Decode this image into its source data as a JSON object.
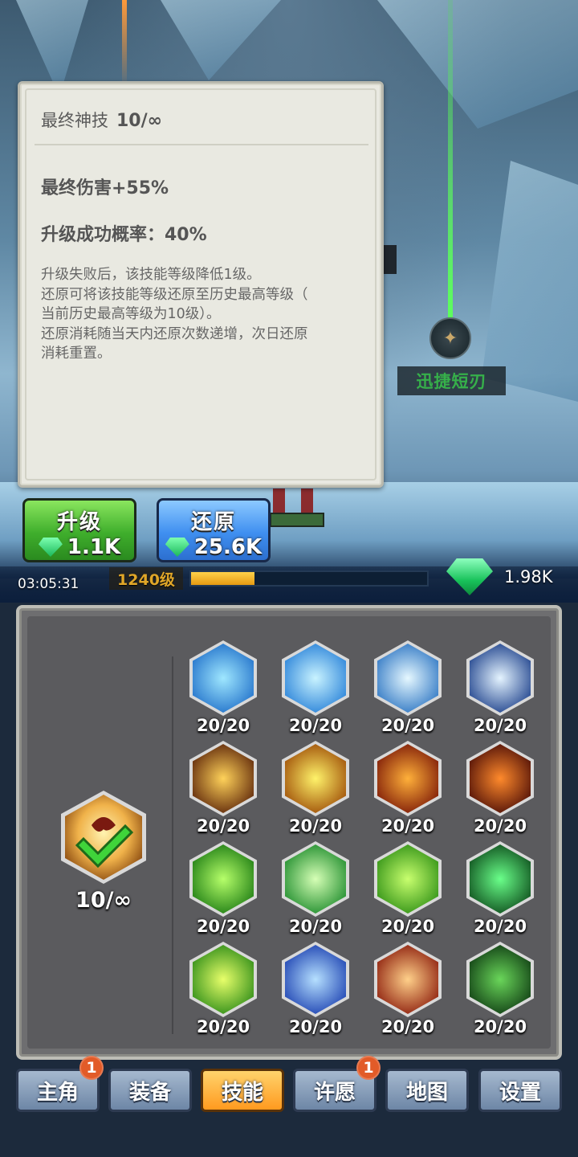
{
  "tooltip": {
    "title": "最终神技",
    "level": "10/∞",
    "effect": "最终伤害+55%",
    "success_rate": "升级成功概率：40%",
    "description": [
      "升级失败后，该技能等级降低1级。",
      "还原可将该技能等级还原至历史最高等级（",
      "当前历史最高等级为10级）。",
      "还原消耗随当天内还原次数递增，次日还原",
      "消耗重置。"
    ]
  },
  "scene": {
    "dagger_label": "迅捷短刃",
    "dagger_icon": "dagger-icon"
  },
  "actions": {
    "upgrade": {
      "label": "升级",
      "cost": "1.1K",
      "icon": "gem-icon",
      "color": "#3fae2c"
    },
    "restore": {
      "label": "还原",
      "cost": "25.6K",
      "icon": "gem-icon",
      "color": "#3f8ff0"
    }
  },
  "status": {
    "timer": "03:05:31",
    "player_level": "1240级",
    "xp_fraction": 0.27,
    "gem_total": "1.98K"
  },
  "main_skill": {
    "level": "10/∞",
    "icon": "final-skill-checkmark-icon"
  },
  "skills": [
    {
      "name": "ice-burst-icon",
      "count": "20/20",
      "colors": [
        "#9fe7ff",
        "#1f6fc9"
      ]
    },
    {
      "name": "ice-tornado-icon",
      "count": "20/20",
      "colors": [
        "#c9f3ff",
        "#2680d8"
      ]
    },
    {
      "name": "frost-wave-icon",
      "count": "20/20",
      "colors": [
        "#e6f8ff",
        "#2b74c2"
      ]
    },
    {
      "name": "ice-shards-icon",
      "count": "20/20",
      "colors": [
        "#e5f4ff",
        "#1b3f8a"
      ]
    },
    {
      "name": "fire-pillars-icon",
      "count": "20/20",
      "colors": [
        "#ffd25a",
        "#5a2208"
      ]
    },
    {
      "name": "sun-orb-icon",
      "count": "20/20",
      "colors": [
        "#fff36a",
        "#9c4a05"
      ]
    },
    {
      "name": "fire-swirl-icon",
      "count": "20/20",
      "colors": [
        "#ffb03a",
        "#7a1606"
      ]
    },
    {
      "name": "fire-ring-icon",
      "count": "20/20",
      "colors": [
        "#ff8a2c",
        "#4a0c06"
      ]
    },
    {
      "name": "wind-slash-icon",
      "count": "20/20",
      "colors": [
        "#b6ff6a",
        "#1b7a12"
      ]
    },
    {
      "name": "green-lightning-icon",
      "count": "20/20",
      "colors": [
        "#d6ffb6",
        "#1b8a2a"
      ]
    },
    {
      "name": "green-vortex-icon",
      "count": "20/20",
      "colors": [
        "#c8ff6e",
        "#2e8f14"
      ]
    },
    {
      "name": "pentagram-icon",
      "count": "20/20",
      "colors": [
        "#6aff8a",
        "#0c4a1a"
      ]
    },
    {
      "name": "heal-heart-icon",
      "count": "20/20",
      "colors": [
        "#e8ff6a",
        "#2a8a16"
      ]
    },
    {
      "name": "blue-whirlpool-icon",
      "count": "20/20",
      "colors": [
        "#b6e0ff",
        "#1a3fb0"
      ]
    },
    {
      "name": "red-flames-icon",
      "count": "20/20",
      "colors": [
        "#ffd08a",
        "#8a1a0a"
      ]
    },
    {
      "name": "thorn-vines-icon",
      "count": "20/20",
      "colors": [
        "#6ad65a",
        "#0e3a12"
      ]
    }
  ],
  "tabs": [
    {
      "label": "主角",
      "badge": "1",
      "active": false
    },
    {
      "label": "装备",
      "badge": "",
      "active": false
    },
    {
      "label": "技能",
      "badge": "",
      "active": true
    },
    {
      "label": "许愿",
      "badge": "1",
      "active": false
    },
    {
      "label": "地图",
      "badge": "",
      "active": false
    },
    {
      "label": "设置",
      "badge": "",
      "active": false
    }
  ]
}
